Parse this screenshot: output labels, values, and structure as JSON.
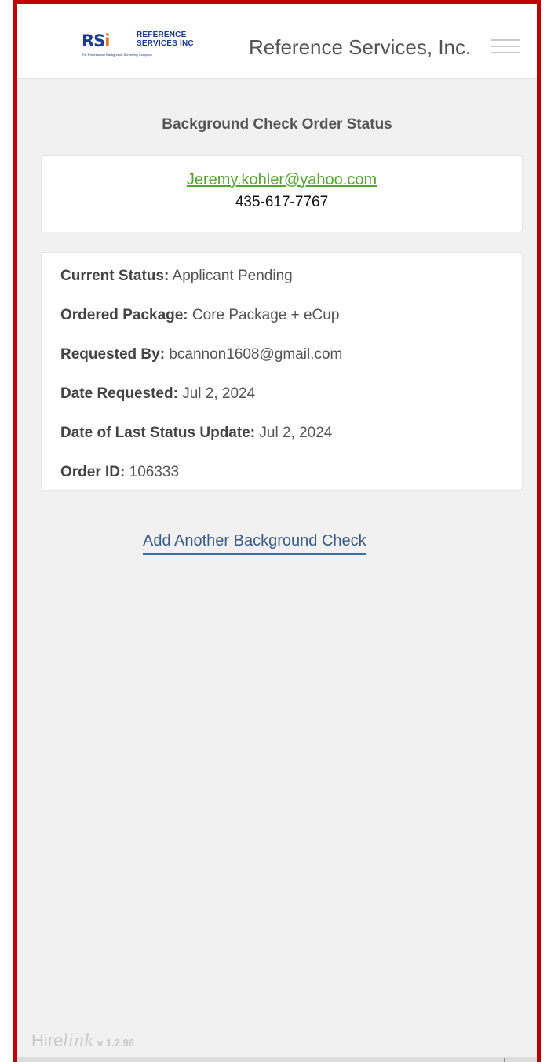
{
  "header": {
    "logo_mark": "RS",
    "logo_accent": "i",
    "logo_line1": "REFERENCE",
    "logo_line2": "SERVICES INC",
    "logo_tagline": "The Professional Background Screening Company",
    "app_title": "Reference Services, Inc.",
    "menu_icon": "hamburger-menu-icon"
  },
  "page": {
    "title": "Background Check Order Status"
  },
  "contact": {
    "email": "Jeremy.kohler@yahoo.com",
    "phone": "435-617-7767"
  },
  "status": {
    "current_status_label": "Current Status:",
    "current_status_value": "Applicant Pending",
    "ordered_package_label": "Ordered Package:",
    "ordered_package_value": "Core Package + eCup",
    "requested_by_label": "Requested By:",
    "requested_by_value": "bcannon1608@gmail.com",
    "date_requested_label": "Date Requested:",
    "date_requested_value": "Jul 2, 2024",
    "last_update_label": "Date of Last Status Update:",
    "last_update_value": "Jul 2, 2024",
    "order_id_label": "Order ID:",
    "order_id_value": "106333"
  },
  "actions": {
    "add_another": "Add Another Background Check"
  },
  "footer": {
    "brand_hire": "Hire",
    "brand_link": "link",
    "version": "v 1.2.96"
  },
  "colors": {
    "frame_border": "#c00000",
    "email_link": "#55a630",
    "action_link": "#3a5a8a",
    "background": "#f1f1f1"
  }
}
